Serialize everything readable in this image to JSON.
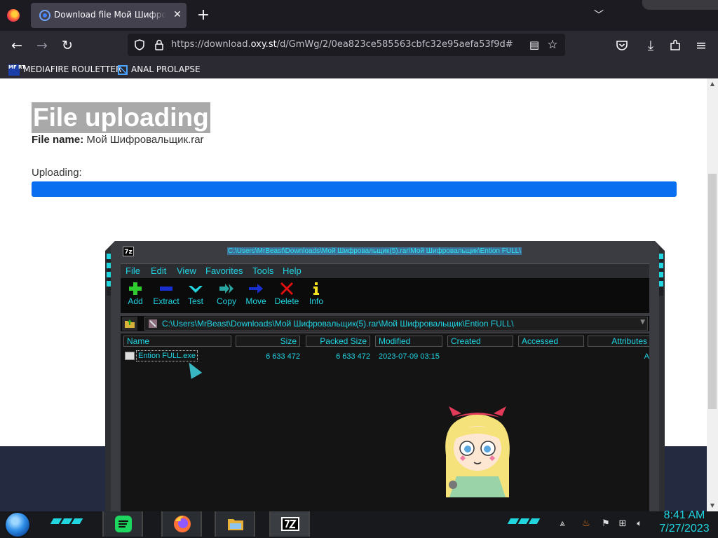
{
  "browser": {
    "tab": {
      "title": "Download file Мой Шифровальщик.rar"
    },
    "url": {
      "prefix": "https://download.",
      "domain": "oxy.st",
      "path": "/d/GmWg/2/0ea823ce585563cbfc32e95aefa53f9d#"
    },
    "bookmarks": [
      {
        "label": "MEDIAFIRE ROULETTER",
        "icon_text": "MF RT"
      },
      {
        "label": "ANAL PROLAPSE"
      }
    ]
  },
  "page": {
    "title": "File uploading",
    "file_name_label": "File name:",
    "file_name": "Мой Шифровальщик.rar",
    "uploading_label": "Uploading:",
    "progress_fraction": 1.0,
    "progress_color": "#0a6ef0"
  },
  "sevenzip": {
    "app_icon": "7z",
    "title": "C:\\Users\\MrBeast\\Downloads\\Мой Шифровальщик(5).rar\\Мой Шифровальщик\\Ention FULL\\",
    "menu": [
      "File",
      "Edit",
      "View",
      "Favorites",
      "Tools",
      "Help"
    ],
    "toolbar": [
      {
        "label": "Add",
        "icon": "plus-icon",
        "color": "#2ecc2e"
      },
      {
        "label": "Extract",
        "icon": "minus-icon",
        "color": "#1a2fd0"
      },
      {
        "label": "Test",
        "icon": "check-icon",
        "color": "#22d6e0"
      },
      {
        "label": "Copy",
        "icon": "double-arrow-right-icon",
        "color": "#2aa6a0"
      },
      {
        "label": "Move",
        "icon": "arrow-right-icon",
        "color": "#1a2fd0"
      },
      {
        "label": "Delete",
        "icon": "x-icon",
        "color": "#e01010"
      },
      {
        "label": "Info",
        "icon": "info-icon",
        "color": "#f0e020"
      }
    ],
    "address": "C:\\Users\\MrBeast\\Downloads\\Мой Шифровальщик(5).rar\\Мой Шифровальщик\\Ention FULL\\",
    "columns": [
      "Name",
      "Size",
      "Packed Size",
      "Modified",
      "Created",
      "Accessed",
      "Attributes"
    ],
    "rows": [
      {
        "name": "Ention FULL.exe",
        "size": "6 633 472",
        "packed_size": "6 633 472",
        "modified": "2023-07-09 03:15",
        "created": "",
        "accessed": "",
        "attributes": "A"
      }
    ],
    "accent_color": "#21d4e3"
  },
  "taskbar": {
    "apps": [
      "spotify-icon",
      "firefox-icon",
      "file-explorer-icon",
      "7zip-icon"
    ],
    "clock_time": "8:41 AM",
    "clock_date": "7/27/2023"
  }
}
